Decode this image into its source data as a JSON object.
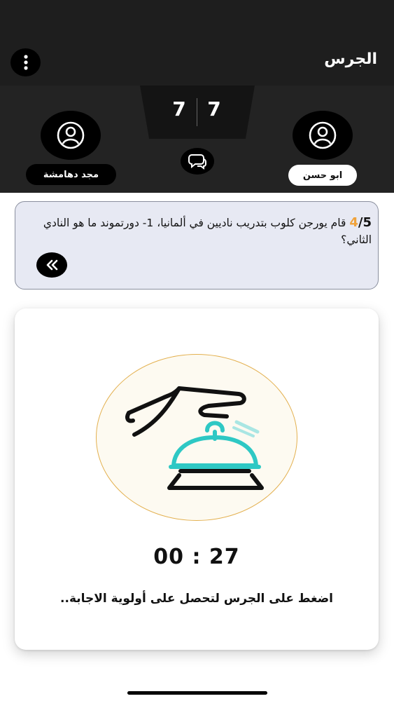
{
  "header": {
    "title": "الجرس"
  },
  "scores": {
    "left": "7",
    "right": "7"
  },
  "players": {
    "right": {
      "name": "ابو حسن"
    },
    "left": {
      "name": "مجد دهامشة"
    }
  },
  "question": {
    "current": "4",
    "total": "5",
    "text": "قام يورجن كلوب بتدريب ناديين في ألمانيا، 1- دورتموند ما هو النادي الثاني؟"
  },
  "buzzer": {
    "timer": "00 : 27",
    "instruction": "اضغط على الجرس لتحصل على أولوية الاجابة.."
  },
  "colors": {
    "header_bg": "#1e1e1e",
    "accent_orange": "#f0a23a",
    "bell_teal": "#2ec8c4",
    "question_bg": "#e7e9f3"
  },
  "icons": {
    "menu": "more-vertical-icon",
    "avatar": "user-icon",
    "chat": "chat-bubbles-icon",
    "next": "double-chevron-left-icon",
    "bell": "service-bell-icon"
  }
}
